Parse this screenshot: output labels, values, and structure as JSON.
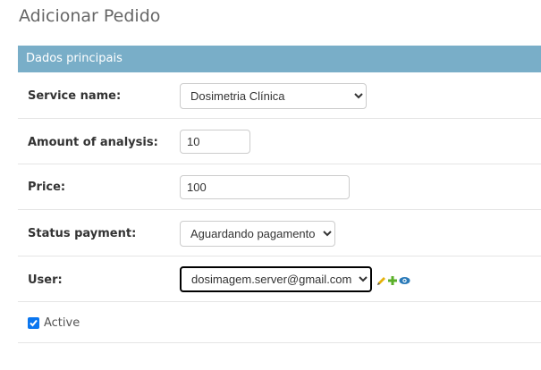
{
  "page": {
    "title": "Adicionar Pedido"
  },
  "fieldset": {
    "title": "Dados principais"
  },
  "fields": {
    "service_name": {
      "label": "Service name:",
      "value": "Dosimetria Clínica"
    },
    "amount_of_analysis": {
      "label": "Amount of analysis:",
      "value": "10"
    },
    "price": {
      "label": "Price:",
      "value": "100"
    },
    "status_payment": {
      "label": "Status payment:",
      "value": "Aguardando pagamento"
    },
    "user": {
      "label": "User:",
      "value": "dosimagem.server@gmail.com"
    },
    "active": {
      "label": "Active",
      "checked": true
    }
  },
  "related_icons": [
    "pencil-icon",
    "plus-icon",
    "eye-icon"
  ],
  "colors": {
    "header_bg": "#79aec8",
    "checkbox": "#0b76ef",
    "focus_border": "#000000"
  }
}
